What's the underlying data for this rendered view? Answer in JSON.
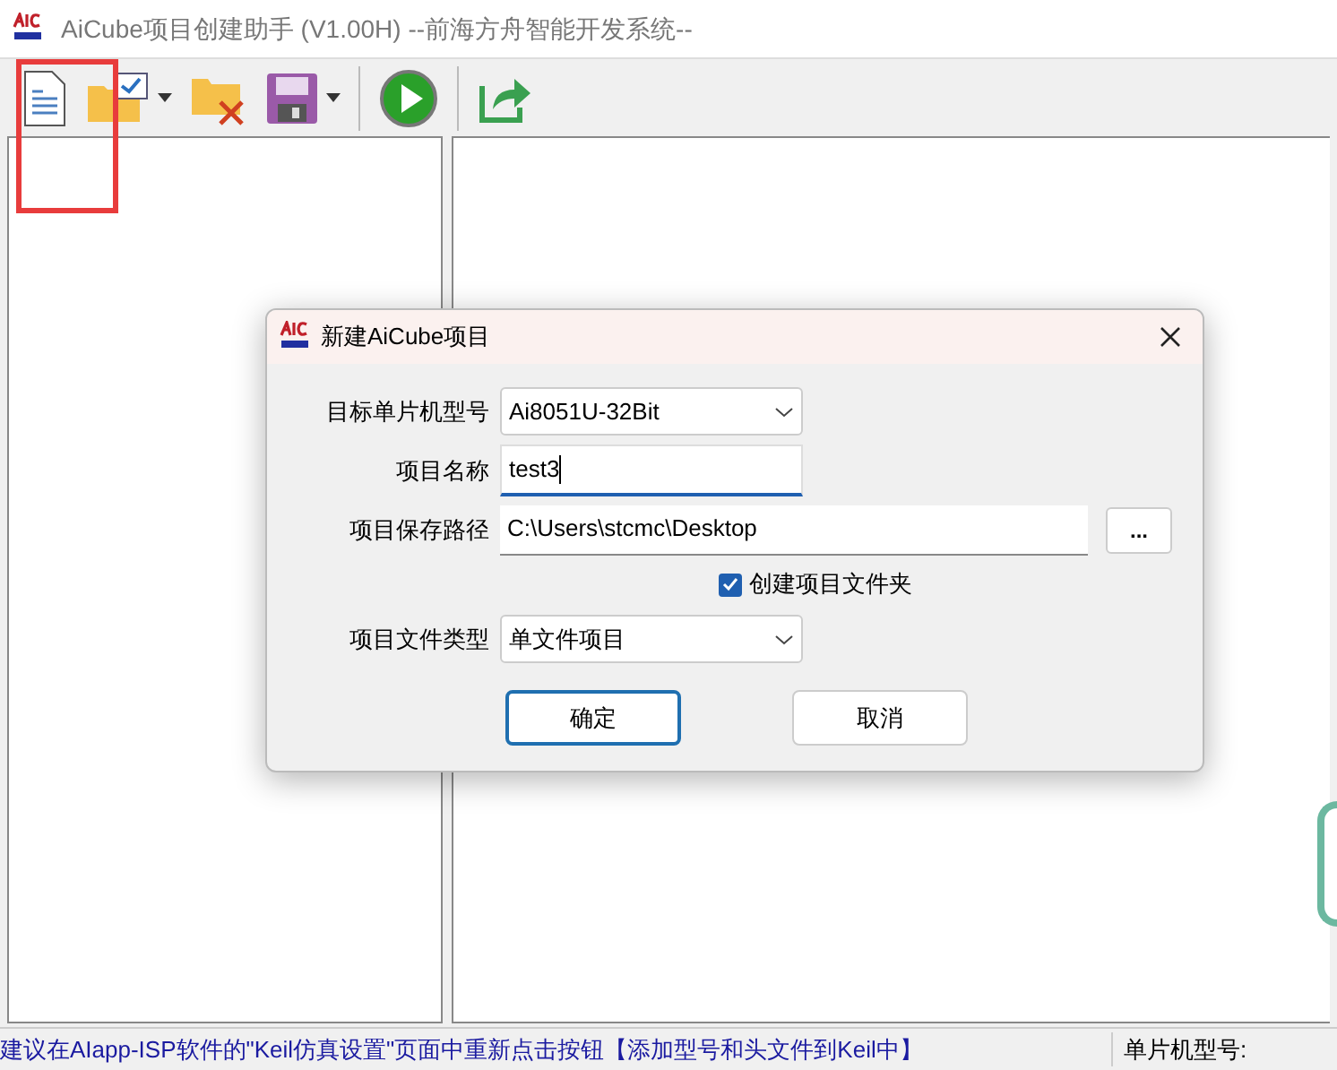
{
  "window": {
    "title": "AiCube项目创建助手 (V1.00H) --前海方舟智能开发系统--"
  },
  "toolbar": {
    "buttons": [
      {
        "kind": "new"
      },
      {
        "kind": "open",
        "dropdown": true
      },
      {
        "kind": "close"
      },
      {
        "kind": "save",
        "dropdown": true
      },
      {
        "kind": "run"
      },
      {
        "kind": "export"
      }
    ]
  },
  "dialog": {
    "title": "新建AiCube项目",
    "fields": [
      {
        "kind": "select",
        "label": "目标单片机型号",
        "value": "Ai8051U-32Bit"
      },
      {
        "kind": "input",
        "label": "项目名称",
        "value": "test3",
        "focused": true
      },
      {
        "kind": "path",
        "label": "项目保存路径",
        "value": "C:\\Users\\stcmc\\Desktop",
        "button": "..."
      },
      {
        "kind": "checkbox",
        "label": "创建项目文件夹",
        "checked": true
      },
      {
        "kind": "select",
        "label": "项目文件类型",
        "value": "单文件项目"
      }
    ],
    "buttons": [
      {
        "label": "确定",
        "default": true
      },
      {
        "label": "取消",
        "default": false
      }
    ]
  },
  "status_bar": {
    "message": "建议在AIapp-ISP软件的\"Keil仿真设置\"页面中重新点击按钮【添加型号和头文件到Keil中】",
    "mcu_label": "单片机型号:"
  }
}
